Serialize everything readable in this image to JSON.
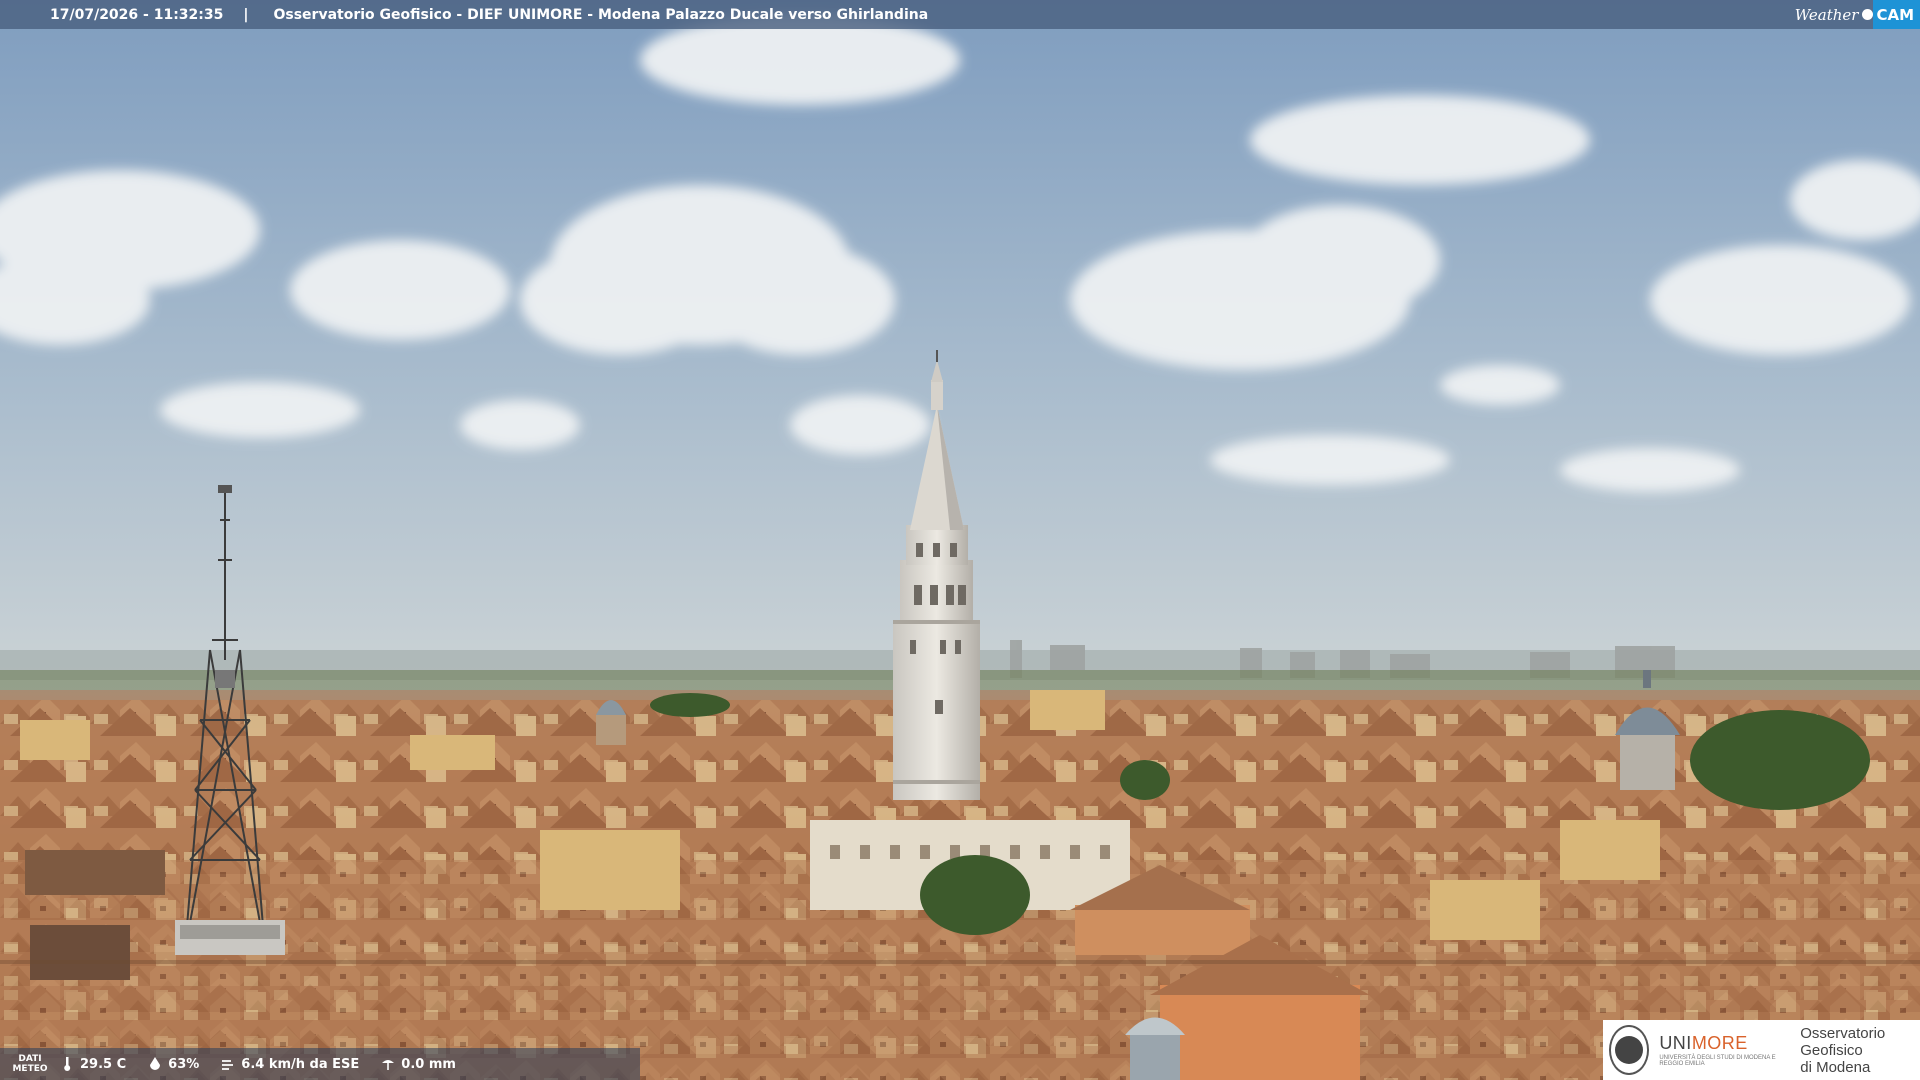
{
  "header": {
    "timestamp": "17/07/2026 - 11:32:35",
    "separator": "|",
    "caption": "Osservatorio Geofisico - DIEF UNIMORE - Modena Palazzo Ducale verso Ghirlandina"
  },
  "brand": {
    "weather_label": "Weather",
    "cam_label": "CAM"
  },
  "meteo": {
    "label_line1": "DATI",
    "label_line2": "METEO",
    "temperature": "29.5 C",
    "humidity": "63%",
    "wind": "6.4 km/h da ESE",
    "rain": "0.0 mm",
    "icons": [
      "thermometer-icon",
      "humidity-drop-icon",
      "wind-icon",
      "rain-gauge-icon"
    ]
  },
  "logo": {
    "uni_part1": "UNI",
    "uni_part2": "MORE",
    "uni_sub": "UNIVERSITÀ DEGLI STUDI DI MODENA E REGGIO EMILIA",
    "observatory_line1": "Osservatorio Geofisico",
    "observatory_line2": "di Modena"
  },
  "colors": {
    "topbar": "#4a6080",
    "cam_accent": "#1e93d6",
    "unimore_accent": "#d9622b",
    "sky_top": "#7f9dbf",
    "sky_bottom": "#c9d2d8",
    "roofs": "#b97d52"
  }
}
